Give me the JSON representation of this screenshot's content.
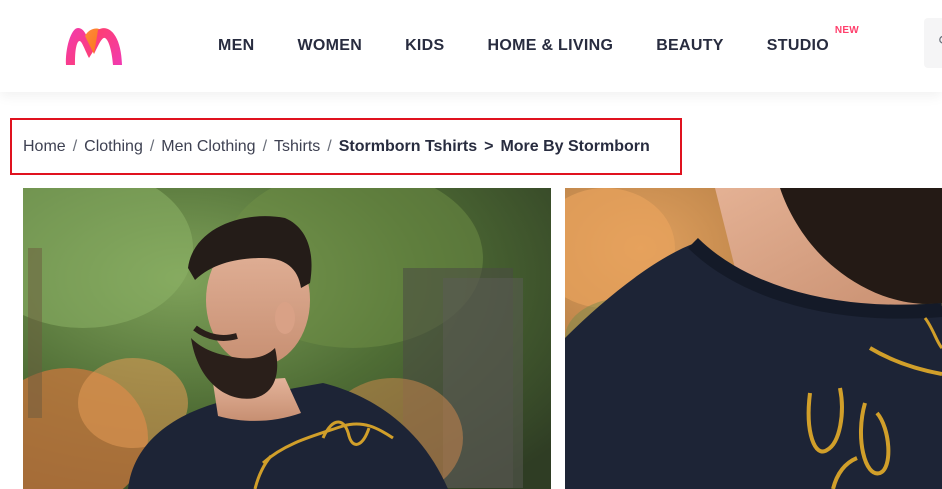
{
  "header": {
    "logo_icon": "myntra-logo-icon",
    "brand_colors": [
      "#ff3f6c",
      "#f13ab1",
      "#f97316"
    ],
    "nav": [
      {
        "label": "MEN"
      },
      {
        "label": "WOMEN"
      },
      {
        "label": "KIDS"
      },
      {
        "label": "HOME & LIVING"
      },
      {
        "label": "BEAUTY"
      },
      {
        "label": "STUDIO",
        "badge": "NEW"
      }
    ],
    "search_icon": "search-icon"
  },
  "breadcrumb": {
    "items": [
      "Home",
      "Clothing",
      "Men Clothing",
      "Tshirts"
    ],
    "separator": "/",
    "brand_crumb": "Stormborn Tshirts",
    "arrow": ">",
    "current": "More By Stormborn",
    "highlight_color": "#e0121f"
  },
  "gallery": {
    "images": [
      {
        "name": "product-image-model-front"
      },
      {
        "name": "product-image-neckline-closeup"
      }
    ]
  }
}
